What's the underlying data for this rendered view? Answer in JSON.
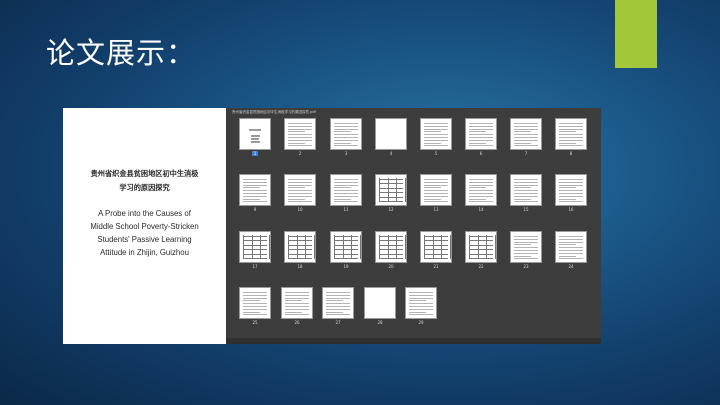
{
  "slide": {
    "title": "论文展示：",
    "accent_color": "#a3c73a"
  },
  "cover": {
    "cn_title_line1": "贵州省织金县贫困地区初中生消极",
    "cn_title_line2": "学习的原因探究",
    "en_title_lines": [
      "A Probe into the Causes of",
      "Middle School Poverty-Stricken",
      "Students' Passive Learning",
      "Attitude in Zhijin, Guizhou"
    ]
  },
  "viewer": {
    "title": "贵州省织金县贫困地区初中生消极学习的原因探究.pdf",
    "selected_page": "1",
    "pages": [
      {
        "num": "1",
        "kind": "cover"
      },
      {
        "num": "2",
        "kind": "text"
      },
      {
        "num": "3",
        "kind": "text"
      },
      {
        "num": "4",
        "kind": "blank"
      },
      {
        "num": "5",
        "kind": "text"
      },
      {
        "num": "6",
        "kind": "text"
      },
      {
        "num": "7",
        "kind": "text"
      },
      {
        "num": "8",
        "kind": "text"
      },
      {
        "num": "9",
        "kind": "text"
      },
      {
        "num": "10",
        "kind": "text"
      },
      {
        "num": "11",
        "kind": "text"
      },
      {
        "num": "12",
        "kind": "table"
      },
      {
        "num": "13",
        "kind": "text"
      },
      {
        "num": "14",
        "kind": "text"
      },
      {
        "num": "15",
        "kind": "text"
      },
      {
        "num": "16",
        "kind": "text"
      },
      {
        "num": "17",
        "kind": "table"
      },
      {
        "num": "18",
        "kind": "table"
      },
      {
        "num": "19",
        "kind": "table"
      },
      {
        "num": "20",
        "kind": "table"
      },
      {
        "num": "21",
        "kind": "table"
      },
      {
        "num": "22",
        "kind": "table"
      },
      {
        "num": "23",
        "kind": "text"
      },
      {
        "num": "24",
        "kind": "text"
      },
      {
        "num": "25",
        "kind": "text"
      },
      {
        "num": "26",
        "kind": "text"
      },
      {
        "num": "27",
        "kind": "text"
      },
      {
        "num": "28",
        "kind": "blank"
      },
      {
        "num": "29",
        "kind": "text"
      }
    ]
  }
}
